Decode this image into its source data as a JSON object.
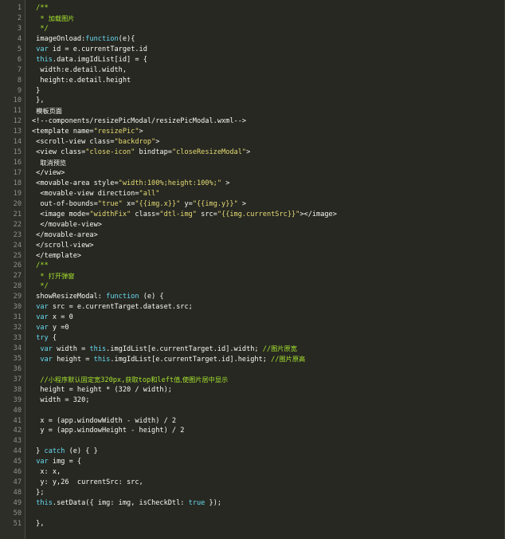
{
  "editor": {
    "lines": [
      {
        "n": "1",
        "tokens": [
          {
            "t": " /**",
            "c": "t-comment"
          }
        ]
      },
      {
        "n": "2",
        "tokens": [
          {
            "t": "  * ",
            "c": "t-comment"
          },
          {
            "t": "加载图片",
            "c": "t-cjk"
          }
        ]
      },
      {
        "n": "3",
        "tokens": [
          {
            "t": "  */",
            "c": "t-comment"
          }
        ]
      },
      {
        "n": "4",
        "tokens": [
          {
            "t": " imageOnload:",
            "c": "t-plain"
          },
          {
            "t": "function",
            "c": "t-kw"
          },
          {
            "t": "(e){",
            "c": "t-plain"
          }
        ]
      },
      {
        "n": "5",
        "tokens": [
          {
            "t": " ",
            "c": "t-plain"
          },
          {
            "t": "var",
            "c": "t-kw"
          },
          {
            "t": " id = e.currentTarget.id",
            "c": "t-plain"
          }
        ]
      },
      {
        "n": "6",
        "tokens": [
          {
            "t": " ",
            "c": "t-plain"
          },
          {
            "t": "this",
            "c": "t-kw"
          },
          {
            "t": ".data.imgIdList[id] = {",
            "c": "t-plain"
          }
        ]
      },
      {
        "n": "7",
        "tokens": [
          {
            "t": "  width:e.detail.width,",
            "c": "t-plain"
          }
        ]
      },
      {
        "n": "8",
        "tokens": [
          {
            "t": "  height:e.detail.height",
            "c": "t-plain"
          }
        ]
      },
      {
        "n": "9",
        "tokens": [
          {
            "t": " }",
            "c": "t-plain"
          }
        ]
      },
      {
        "n": "10",
        "tokens": [
          {
            "t": " },",
            "c": "t-plain"
          }
        ]
      },
      {
        "n": "11",
        "tokens": [
          {
            "t": " ",
            "c": "t-plain"
          },
          {
            "t": "模板页面",
            "c": "t-cjkplain"
          }
        ]
      },
      {
        "n": "12",
        "tokens": [
          {
            "t": "<!--components/resizePicModal/resizePicModal.wxml-->",
            "c": "t-plain"
          }
        ]
      },
      {
        "n": "13",
        "tokens": [
          {
            "t": "<template name=",
            "c": "t-plain"
          },
          {
            "t": "\"resizePic\"",
            "c": "t-str"
          },
          {
            "t": ">",
            "c": "t-plain"
          }
        ]
      },
      {
        "n": "14",
        "tokens": [
          {
            "t": " <scroll-view class=",
            "c": "t-plain"
          },
          {
            "t": "\"backdrop\"",
            "c": "t-str"
          },
          {
            "t": ">",
            "c": "t-plain"
          }
        ]
      },
      {
        "n": "15",
        "tokens": [
          {
            "t": " <view class=",
            "c": "t-plain"
          },
          {
            "t": "\"close-icon\"",
            "c": "t-str"
          },
          {
            "t": " bindtap=",
            "c": "t-plain"
          },
          {
            "t": "\"closeResizeModal\"",
            "c": "t-str"
          },
          {
            "t": ">",
            "c": "t-plain"
          }
        ]
      },
      {
        "n": "16",
        "tokens": [
          {
            "t": "  ",
            "c": "t-plain"
          },
          {
            "t": "取消预览",
            "c": "t-cjkplain"
          }
        ]
      },
      {
        "n": "17",
        "tokens": [
          {
            "t": " </view>",
            "c": "t-plain"
          }
        ]
      },
      {
        "n": "18",
        "tokens": [
          {
            "t": " <movable-area style=",
            "c": "t-plain"
          },
          {
            "t": "\"width:100%;height:100%;\"",
            "c": "t-str"
          },
          {
            "t": " >",
            "c": "t-plain"
          }
        ]
      },
      {
        "n": "19",
        "tokens": [
          {
            "t": "  <movable-view direction=",
            "c": "t-plain"
          },
          {
            "t": "\"all\"",
            "c": "t-str"
          }
        ]
      },
      {
        "n": "20",
        "tokens": [
          {
            "t": "  out-of-bounds=",
            "c": "t-plain"
          },
          {
            "t": "\"true\"",
            "c": "t-str"
          },
          {
            "t": " x=",
            "c": "t-plain"
          },
          {
            "t": "\"{{img.x}}\"",
            "c": "t-str"
          },
          {
            "t": " y=",
            "c": "t-plain"
          },
          {
            "t": "\"{{img.y}}\"",
            "c": "t-str"
          },
          {
            "t": " >",
            "c": "t-plain"
          }
        ]
      },
      {
        "n": "21",
        "tokens": [
          {
            "t": "  <image mode=",
            "c": "t-plain"
          },
          {
            "t": "\"widthFix\"",
            "c": "t-str"
          },
          {
            "t": " class=",
            "c": "t-plain"
          },
          {
            "t": "\"dtl-img\"",
            "c": "t-str"
          },
          {
            "t": " src=",
            "c": "t-plain"
          },
          {
            "t": "\"{{img.currentSrc}}\"",
            "c": "t-str"
          },
          {
            "t": "></image>",
            "c": "t-plain"
          }
        ]
      },
      {
        "n": "22",
        "tokens": [
          {
            "t": "  </movable-view>",
            "c": "t-plain"
          }
        ]
      },
      {
        "n": "23",
        "tokens": [
          {
            "t": " </movable-area>",
            "c": "t-plain"
          }
        ]
      },
      {
        "n": "24",
        "tokens": [
          {
            "t": " </scroll-view>",
            "c": "t-plain"
          }
        ]
      },
      {
        "n": "25",
        "tokens": [
          {
            "t": " </template>",
            "c": "t-plain"
          }
        ]
      },
      {
        "n": "26",
        "tokens": [
          {
            "t": " /**",
            "c": "t-comment"
          }
        ]
      },
      {
        "n": "27",
        "tokens": [
          {
            "t": "  * ",
            "c": "t-comment"
          },
          {
            "t": "打开弹窗",
            "c": "t-cjk"
          }
        ]
      },
      {
        "n": "28",
        "tokens": [
          {
            "t": "  */",
            "c": "t-comment"
          }
        ]
      },
      {
        "n": "29",
        "tokens": [
          {
            "t": " showResizeModal: ",
            "c": "t-plain"
          },
          {
            "t": "function",
            "c": "t-kw"
          },
          {
            "t": " (e) {",
            "c": "t-plain"
          }
        ]
      },
      {
        "n": "30",
        "tokens": [
          {
            "t": " ",
            "c": "t-plain"
          },
          {
            "t": "var",
            "c": "t-kw"
          },
          {
            "t": " src = e.currentTarget.dataset.src;",
            "c": "t-plain"
          }
        ]
      },
      {
        "n": "31",
        "tokens": [
          {
            "t": " ",
            "c": "t-plain"
          },
          {
            "t": "var",
            "c": "t-kw"
          },
          {
            "t": " x = 0",
            "c": "t-plain"
          }
        ]
      },
      {
        "n": "32",
        "tokens": [
          {
            "t": " ",
            "c": "t-plain"
          },
          {
            "t": "var",
            "c": "t-kw"
          },
          {
            "t": " y =0",
            "c": "t-plain"
          }
        ]
      },
      {
        "n": "33",
        "tokens": [
          {
            "t": " ",
            "c": "t-plain"
          },
          {
            "t": "try",
            "c": "t-kw"
          },
          {
            "t": " {",
            "c": "t-plain"
          }
        ]
      },
      {
        "n": "34",
        "tokens": [
          {
            "t": "  ",
            "c": "t-plain"
          },
          {
            "t": "var",
            "c": "t-kw"
          },
          {
            "t": " width = ",
            "c": "t-plain"
          },
          {
            "t": "this",
            "c": "t-kw"
          },
          {
            "t": ".imgIdList[e.currentTarget.id].width; ",
            "c": "t-plain"
          },
          {
            "t": "//",
            "c": "t-comment"
          },
          {
            "t": "图片原宽",
            "c": "t-cjk"
          }
        ]
      },
      {
        "n": "35",
        "tokens": [
          {
            "t": "  ",
            "c": "t-plain"
          },
          {
            "t": "var",
            "c": "t-kw"
          },
          {
            "t": " height = ",
            "c": "t-plain"
          },
          {
            "t": "this",
            "c": "t-kw"
          },
          {
            "t": ".imgIdList[e.currentTarget.id].height; ",
            "c": "t-plain"
          },
          {
            "t": "//",
            "c": "t-comment"
          },
          {
            "t": "图片原高",
            "c": "t-cjk"
          }
        ]
      },
      {
        "n": "36",
        "tokens": []
      },
      {
        "n": "37",
        "tokens": [
          {
            "t": "  //",
            "c": "t-comment"
          },
          {
            "t": "小程序默认固定宽",
            "c": "t-cjk"
          },
          {
            "t": "320px,",
            "c": "t-comment"
          },
          {
            "t": "获取",
            "c": "t-cjk"
          },
          {
            "t": "top",
            "c": "t-comment"
          },
          {
            "t": "和",
            "c": "t-cjk"
          },
          {
            "t": "left",
            "c": "t-comment"
          },
          {
            "t": "值,使图片居中显示",
            "c": "t-cjk"
          }
        ]
      },
      {
        "n": "38",
        "tokens": [
          {
            "t": "  height = height * (320 / width);",
            "c": "t-plain"
          }
        ]
      },
      {
        "n": "39",
        "tokens": [
          {
            "t": "  width = 320;",
            "c": "t-plain"
          }
        ]
      },
      {
        "n": "40",
        "tokens": []
      },
      {
        "n": "41",
        "tokens": [
          {
            "t": "  x = (app.windowWidth - width) / 2",
            "c": "t-plain"
          }
        ]
      },
      {
        "n": "42",
        "tokens": [
          {
            "t": "  y = (app.windowHeight - height) / 2",
            "c": "t-plain"
          }
        ]
      },
      {
        "n": "43",
        "tokens": []
      },
      {
        "n": "44",
        "tokens": [
          {
            "t": " } ",
            "c": "t-plain"
          },
          {
            "t": "catch",
            "c": "t-kw"
          },
          {
            "t": " (e) { }",
            "c": "t-plain"
          }
        ]
      },
      {
        "n": "45",
        "tokens": [
          {
            "t": " ",
            "c": "t-plain"
          },
          {
            "t": "var",
            "c": "t-kw"
          },
          {
            "t": " img = {",
            "c": "t-plain"
          }
        ]
      },
      {
        "n": "46",
        "tokens": [
          {
            "t": "  x: x,",
            "c": "t-plain"
          }
        ]
      },
      {
        "n": "47",
        "tokens": [
          {
            "t": "  y: y,26  currentSrc: src,",
            "c": "t-plain"
          }
        ]
      },
      {
        "n": "48",
        "tokens": [
          {
            "t": " };",
            "c": "t-plain"
          }
        ]
      },
      {
        "n": "49",
        "tokens": [
          {
            "t": " ",
            "c": "t-plain"
          },
          {
            "t": "this",
            "c": "t-kw"
          },
          {
            "t": ".setData({ img: img, isCheckDtl: ",
            "c": "t-plain"
          },
          {
            "t": "true",
            "c": "t-kw"
          },
          {
            "t": " });",
            "c": "t-plain"
          }
        ]
      },
      {
        "n": "50",
        "tokens": []
      },
      {
        "n": "51",
        "tokens": [
          {
            "t": " },",
            "c": "t-plain"
          }
        ]
      }
    ]
  }
}
